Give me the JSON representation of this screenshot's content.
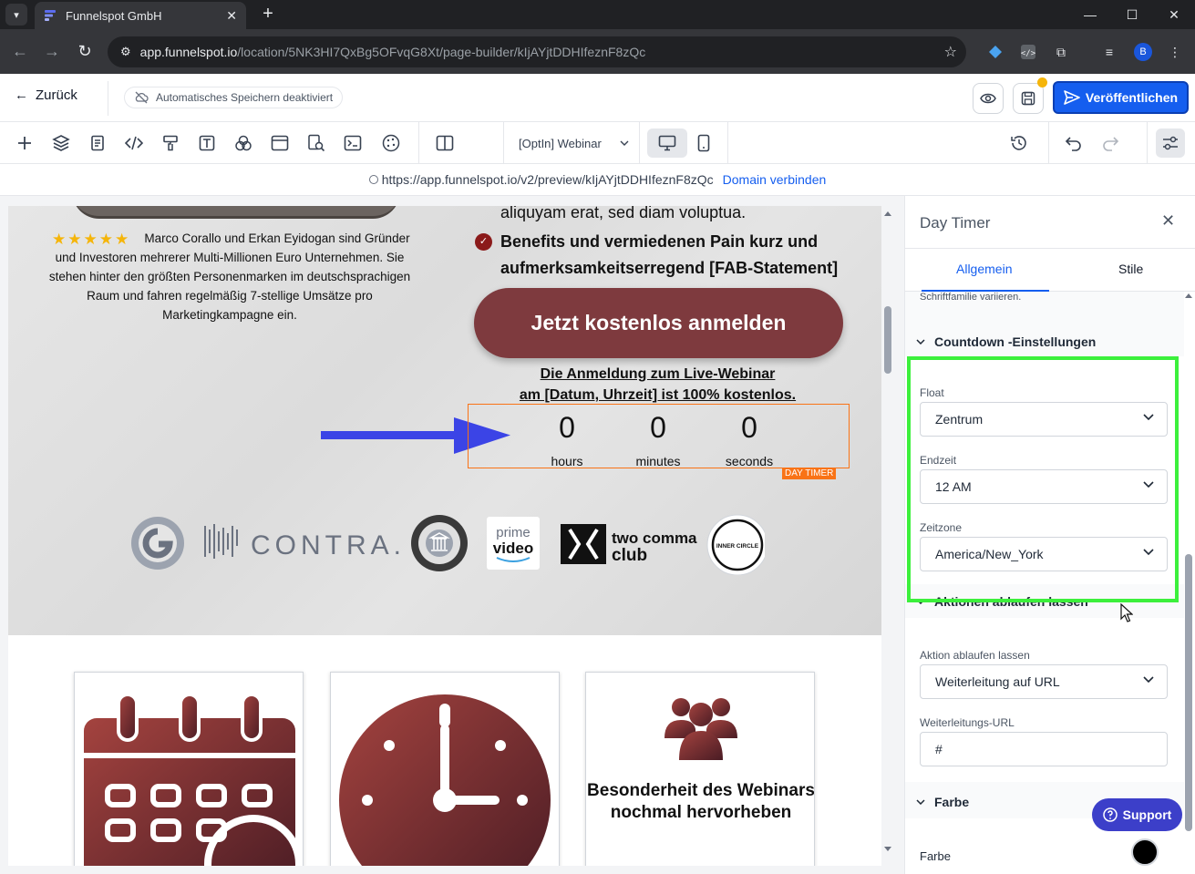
{
  "browser": {
    "tab_title": "Funnelspot GmbH",
    "url_host": "app.funnelspot.io",
    "url_path": "/location/5NK3HI7QxBg5OFvqG8Xt/page-builder/kIjAYjtDDHIfeznF8zQc",
    "profile_initial": "B"
  },
  "header": {
    "back_label": "Zurück",
    "autosave_label": "Automatisches Speichern deaktiviert",
    "publish_label": "Veröffentlichen"
  },
  "toolbar": {
    "page_select": "[OptIn] Webinar"
  },
  "preview": {
    "url": "https://app.funnelspot.io/v2/preview/kIjAYjtDDHIfeznF8zQc",
    "domain_link": "Domain verbinden"
  },
  "canvas": {
    "bio": "Marco Corallo und Erkan Eyidogan sind Gründer und Investoren mehrerer Multi-Millionen Euro Unternehmen. Sie stehen hinter den größten Personenmarken im deutschsprachigen Raum und fahren regelmäßig 7-stellige Umsätze pro Marketingkampagne ein.",
    "stars": "★★★★★",
    "benefit_fragment": "aliquyam erat, sed diam voluptua.",
    "benefit": "Benefits und vermiedenen Pain kurz und aufmerksamkeitserregend [FAB-Statement]",
    "cta_label": "Jetzt kostenlos anmelden",
    "note_line1": "Die Anmeldung zum Live-Webinar",
    "note_line2": "am [Datum, Uhrzeit] ist 100% kostenlos.",
    "timer": {
      "hours": "0",
      "hours_label": "hours",
      "minutes": "0",
      "minutes_label": "minutes",
      "seconds": "0",
      "seconds_label": "seconds",
      "tag": "DAY TIMER"
    },
    "logos": {
      "contra": "CONTRA.",
      "prime": "prime",
      "video": "video",
      "two_comma": "two comma",
      "club": "club",
      "inner_circle": "INNER CIRCLE"
    },
    "card3_text": "Besonderheit des Webinars nochmal hervorheben"
  },
  "panel": {
    "title": "Day Timer",
    "tab_general": "Allgemein",
    "tab_styles": "Stile",
    "faded_text": "Schriftfamilie variieren.",
    "countdown_section": "Countdown -Einstellungen",
    "float_label": "Float",
    "float_value": "Zentrum",
    "endtime_label": "Endzeit",
    "endtime_value": "12 AM",
    "timezone_label": "Zeitzone",
    "timezone_value": "America/New_York",
    "actions_section": "Aktionen ablaufen lassen",
    "action_label": "Aktion ablaufen lassen",
    "action_value": "Weiterleitung auf URL",
    "redirect_label": "Weiterleitungs-URL",
    "redirect_value": "#",
    "color_section": "Farbe",
    "color_label": "Farbe",
    "support_label": "Support"
  },
  "colors": {
    "accent": "#155eef",
    "cta": "#7e3a3e",
    "highlight": "#3cf03c",
    "timer_border": "#f97316"
  }
}
